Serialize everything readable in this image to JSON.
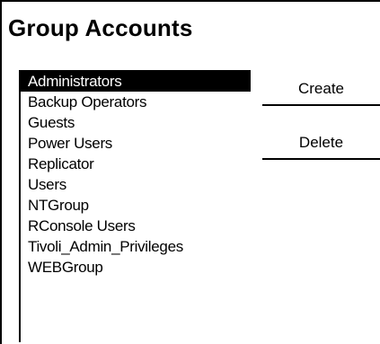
{
  "title": "Group Accounts",
  "list": {
    "items": [
      "Administrators",
      "Backup Operators",
      "Guests",
      "Power Users",
      "Replicator",
      "Users",
      "NTGroup",
      "RConsole Users",
      "Tivoli_Admin_Privileges",
      "WEBGroup"
    ],
    "selected_index": 0
  },
  "buttons": {
    "create": "Create",
    "delete": "Delete"
  }
}
